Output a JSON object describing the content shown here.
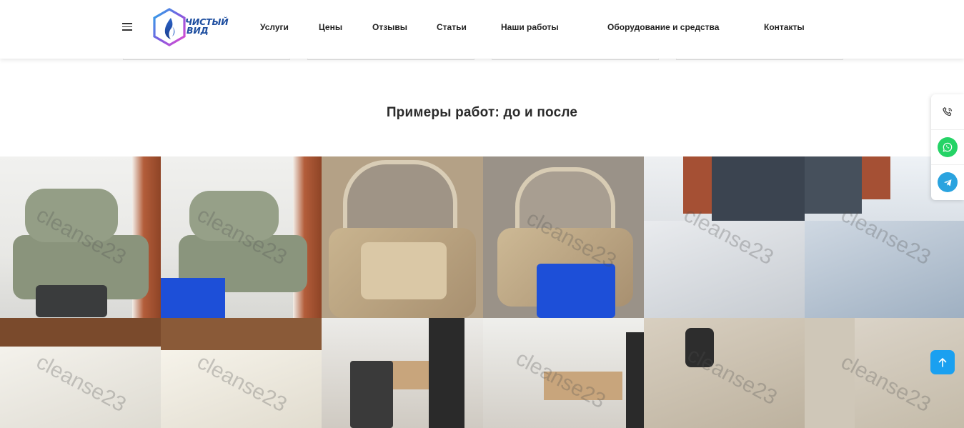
{
  "header": {
    "logo_line1": "ЧИСТЫЙ",
    "logo_line2": "ВИД",
    "nav": [
      "Услуги",
      "Цены",
      "Отзывы",
      "Статьи",
      "Наши работы",
      "Оборудование и средства",
      "Контакты"
    ]
  },
  "section": {
    "title": "Примеры работ: до и после"
  },
  "gallery": {
    "watermark": "cleanse23"
  },
  "side_contacts": {
    "icons": [
      "phone-icon",
      "whatsapp-icon",
      "telegram-icon"
    ],
    "whatsapp_color": "#25d366",
    "telegram_color": "#2aa3df"
  },
  "scroll_top": {
    "icon": "arrow-up-icon",
    "color": "#1aa0f0"
  }
}
